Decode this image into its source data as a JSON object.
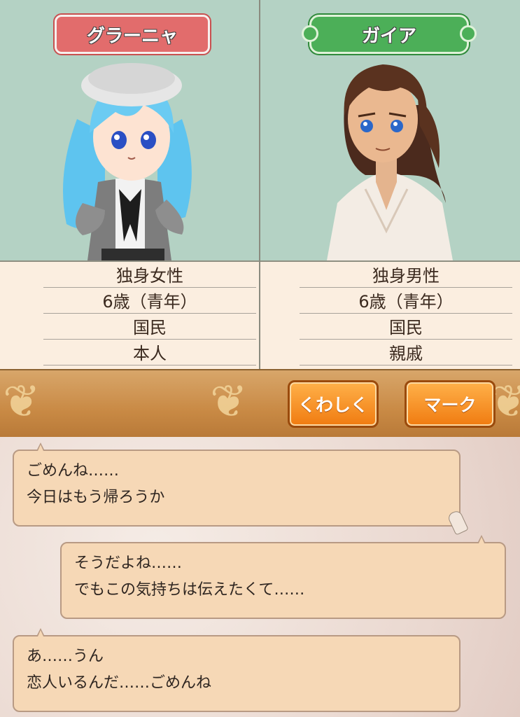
{
  "left": {
    "name": "グラーニャ",
    "info": [
      "独身女性",
      "6歳（青年）",
      "国民",
      "本人"
    ]
  },
  "right": {
    "name": "ガイア",
    "info": [
      "独身男性",
      "6歳（青年）",
      "国民",
      "親戚"
    ]
  },
  "toolbar": {
    "details_label": "くわしく",
    "mark_label": "マーク"
  },
  "chat": [
    {
      "line1": "ごめんね……",
      "line2": "今日はもう帰ろうか"
    },
    {
      "line1": "そうだよね……",
      "line2": "でもこの気持ちは伝えたくて……"
    },
    {
      "line1": "あ……うん",
      "line2": "恋人いるんだ……ごめんね"
    }
  ],
  "colors": {
    "left_badge": "#e26c6c",
    "right_badge": "#4caf58",
    "portrait_bg": "#b4d2c4",
    "button": "#f07b10",
    "bubble": "#f6d8b6"
  }
}
